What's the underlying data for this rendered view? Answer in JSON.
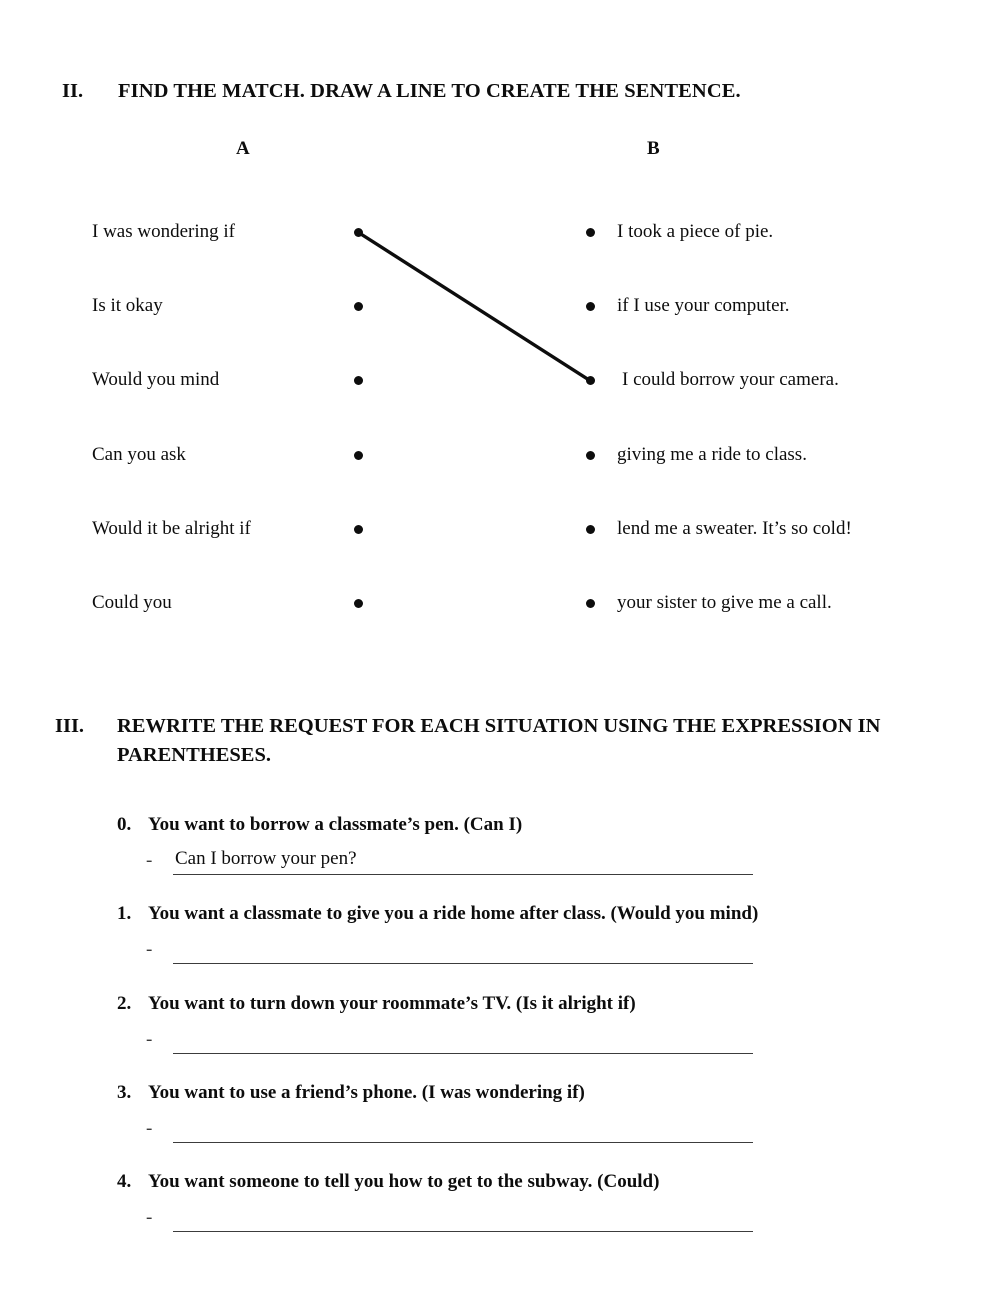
{
  "sections": {
    "matching": {
      "numeral": "II.",
      "title": "FIND THE MATCH. DRAW A LINE TO CREATE THE SENTENCE.",
      "column_a_header": "A",
      "column_b_header": "B",
      "column_a": [
        "I was wondering if",
        "Is it okay",
        "Would you mind",
        "Can you ask",
        "Would it be alright if",
        "Could you"
      ],
      "column_b": [
        "I took a piece of pie.",
        "if I use your computer.",
        "I could borrow your camera.",
        "giving me a ride to class.",
        "lend me a sweater. It’s so cold!",
        "your sister to give me a call."
      ],
      "drawn_connections": [
        {
          "from_index": 0,
          "to_index": 2
        }
      ],
      "line_color": "#0d0d0d"
    },
    "rewrite": {
      "numeral": "III.",
      "title": "REWRITE THE REQUEST FOR EACH SITUATION USING THE EXPRESSION IN PARENTHESES.",
      "items": [
        {
          "number": "0.",
          "prompt": "You want to borrow a classmate’s pen. (Can I)",
          "dash": "-",
          "answer": "Can I borrow your pen?"
        },
        {
          "number": "1.",
          "prompt": "You want a classmate to give you a ride home after class. (Would you mind)",
          "dash": "-",
          "answer": ""
        },
        {
          "number": "2.",
          "prompt": "You want to turn down your roommate’s TV. (Is it alright if)",
          "dash": "-",
          "answer": ""
        },
        {
          "number": "3.",
          "prompt": "You want to use a friend’s phone. (I was wondering if)",
          "dash": "-",
          "answer": ""
        },
        {
          "number": "4.",
          "prompt": "You want someone to tell you how to get to the subway. (Could)",
          "dash": "-",
          "answer": ""
        }
      ]
    }
  }
}
